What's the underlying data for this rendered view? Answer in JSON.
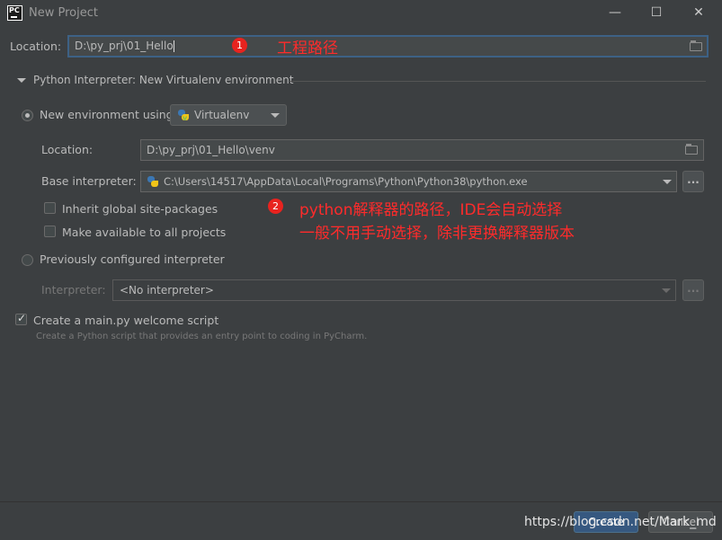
{
  "window": {
    "title": "New Project",
    "minimize": "—",
    "maximize": "☐",
    "close": "✕"
  },
  "location": {
    "label": "Location:",
    "value": "D:\\py_prj\\01_Hello"
  },
  "interpreter_section": {
    "title": "Python Interpreter: New Virtualenv environment"
  },
  "new_env": {
    "radio_label": "New environment using",
    "tool": "Virtualenv",
    "location_label": "Location:",
    "location_value": "D:\\py_prj\\01_Hello\\venv",
    "base_label": "Base interpreter:",
    "base_value": "C:\\Users\\14517\\AppData\\Local\\Programs\\Python\\Python38\\python.exe",
    "dots": "...",
    "inherit_label": "Inherit global site-packages",
    "available_label": "Make available to all projects"
  },
  "prev_env": {
    "radio_label": "Previously configured interpreter",
    "interpreter_label": "Interpreter:",
    "interpreter_value": "<No interpreter>",
    "dots": "..."
  },
  "welcome": {
    "checkbox_label": "Create a main.py welcome script",
    "hint": "Create a Python script that provides an entry point to coding in PyCharm."
  },
  "annotations": {
    "badge1": "1",
    "text1": "工程路径",
    "badge2": "2",
    "text2_line1": "python解释器的路径，IDE会自动选择",
    "text2_line2": "一般不用手动选择，除非更换解释器版本"
  },
  "footer": {
    "create_label": "Create",
    "cancel_label": "Cancel",
    "watermark": "https://blog.csdn.net/Mark_md"
  },
  "colors": {
    "accent": "#3d6185",
    "annotation_red": "#ff2b2b",
    "create_button": "#365880"
  }
}
